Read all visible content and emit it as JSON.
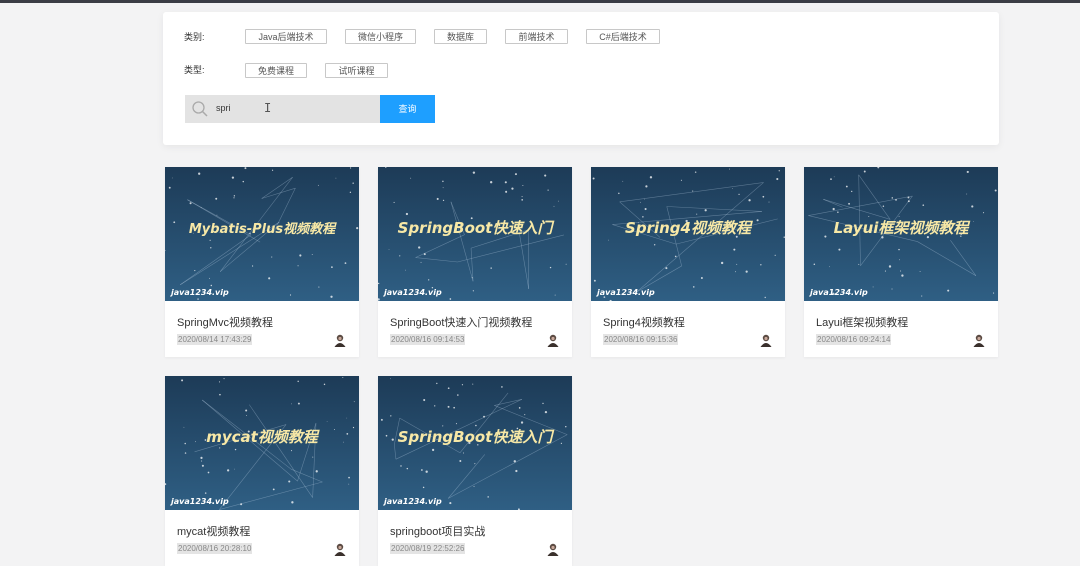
{
  "filters": {
    "category_label": "类别:",
    "type_label": "类型:",
    "categories": [
      "Java后端技术",
      "微信小程序",
      "数据库",
      "前端技术",
      "C#后端技术"
    ],
    "types": [
      "免费课程",
      "试听课程"
    ]
  },
  "search": {
    "value": "spri",
    "cursor_glyph": "I",
    "button_label": "查询"
  },
  "thumb_watermark": "java1234.vip",
  "courses": [
    {
      "banner": "Mybatis-Plus视频教程",
      "title": "SpringMvc视频教程",
      "date": "2020/08/14 17:43:29"
    },
    {
      "banner": "SpringBoot快速入门",
      "title": "SpringBoot快速入门视频教程",
      "date": "2020/08/16 09:14:53"
    },
    {
      "banner": "Spring4视频教程",
      "title": "Spring4视频教程",
      "date": "2020/08/16 09:15:36"
    },
    {
      "banner": "Layui框架视频教程",
      "title": "Layui框架视频教程",
      "date": "2020/08/16 09:24:14"
    },
    {
      "banner": "mycat视频教程",
      "title": "mycat视频教程",
      "date": "2020/08/16 20:28:10"
    },
    {
      "banner": "SpringBoot快速入门",
      "title": "springboot项目实战",
      "date": "2020/08/19 22:52:26"
    }
  ],
  "colors": {
    "accent": "#1e9fff",
    "thumb_bg_top": "#1d3b57",
    "thumb_bg_bottom": "#2f5f84",
    "banner_text": "#f7e8a6"
  }
}
